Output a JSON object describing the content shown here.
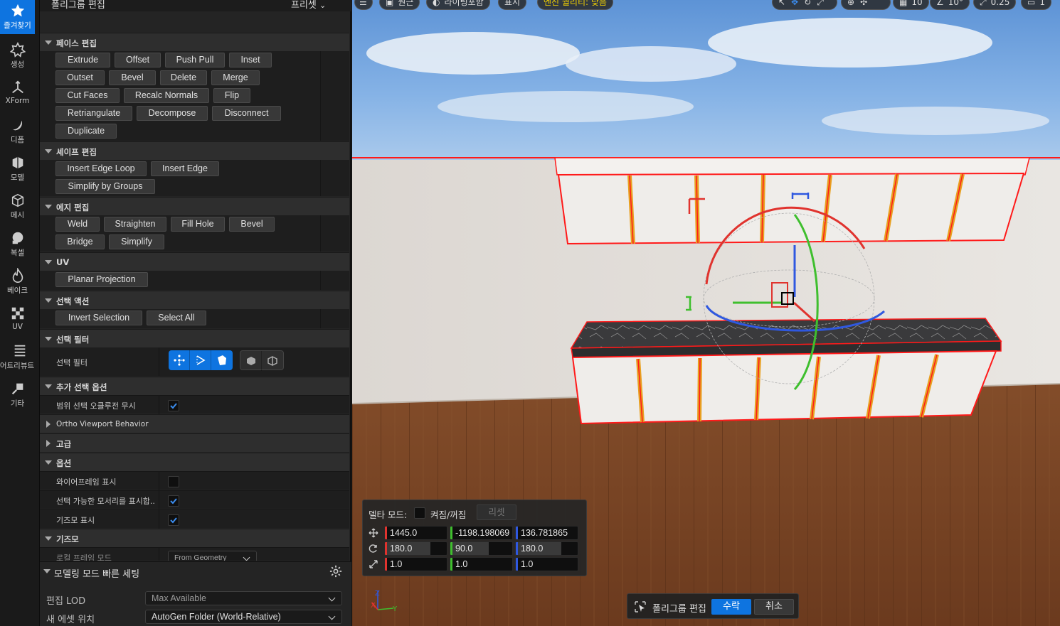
{
  "rail": {
    "items": [
      {
        "label": "즐겨찾기",
        "icon": "star-icon",
        "active": true
      },
      {
        "label": "생성",
        "icon": "create-icon"
      },
      {
        "label": "XForm",
        "icon": "xform-icon"
      },
      {
        "label": "디폼",
        "icon": "deform-icon"
      },
      {
        "label": "모델",
        "icon": "model-icon"
      },
      {
        "label": "메시",
        "icon": "mesh-icon"
      },
      {
        "label": "복셀",
        "icon": "voxel-icon"
      },
      {
        "label": "베이크",
        "icon": "bake-icon"
      },
      {
        "label": "UV",
        "icon": "uv-icon"
      },
      {
        "label": "어트리뷰트",
        "icon": "attributes-icon"
      },
      {
        "label": "기타",
        "icon": "misc-icon"
      }
    ]
  },
  "panel": {
    "title": "폴리그룹 편집",
    "preset_label": "프리셋",
    "sections": {
      "face_edit": "페이스 편집",
      "shape_edit": "셰이프 편집",
      "edge_edit": "에지 편집",
      "uv": "UV",
      "selection_actions": "선택 액션",
      "selection_filter": "선택 필터",
      "extra_selection": "추가 선택 옵션",
      "ortho": "Ortho Viewport Behavior",
      "advanced": "고급",
      "options": "옵션",
      "gizmo": "기즈모"
    },
    "face_buttons": [
      "Extrude",
      "Offset",
      "Push Pull",
      "Inset",
      "Outset",
      "Bevel",
      "Delete",
      "Merge",
      "Cut Faces",
      "Recalc Normals",
      "Flip",
      "Retriangulate",
      "Decompose",
      "Disconnect",
      "Duplicate"
    ],
    "shape_buttons": [
      "Insert Edge Loop",
      "Insert Edge",
      "Simplify by Groups"
    ],
    "edge_buttons": [
      "Weld",
      "Straighten",
      "Fill Hole",
      "Bevel",
      "Bridge",
      "Simplify"
    ],
    "uv_buttons": [
      "Planar Projection"
    ],
    "selection_buttons": [
      "Invert Selection",
      "Select All"
    ],
    "filter_label": "선택 필터",
    "props": {
      "ignore_occlusion": {
        "label": "범위 선택 오클루전 무시",
        "checked": true
      },
      "show_wireframe": {
        "label": "와이어프레임 표시",
        "checked": false
      },
      "show_selectable_edges": {
        "label": "선택 가능한 모서리를 표시합...",
        "checked": true
      },
      "show_gizmo": {
        "label": "기즈모 표시",
        "checked": true
      },
      "local_frame_mode": {
        "label": "로컬 프레임 모드",
        "value": "From Geometry"
      }
    }
  },
  "quick": {
    "title": "모델링 모드 빠른 세팅",
    "edit_lod_label": "편집 LOD",
    "edit_lod_value": "Max Available",
    "asset_location_label": "새 에셋 위치",
    "asset_location_value": "AutoGen Folder (World-Relative)"
  },
  "viewport": {
    "toolbar": {
      "perspective": "원근",
      "lighting": "라이팅포함",
      "show": "표시",
      "scalability": "엔진 퀄리티: 낮음",
      "grid_snap": "10",
      "rot_snap": "10°",
      "scale_snap": "0.25",
      "camera_speed": "1"
    },
    "delta": {
      "mode_label": "델타 모드:",
      "onoff_label": "켜짐/꺼짐",
      "reset_label": "리셋",
      "location": [
        "1445.0",
        "-1198.198069",
        "136.781865"
      ],
      "rotation": [
        "180.0",
        "90.0",
        "180.0"
      ],
      "scale": [
        "1.0",
        "1.0",
        "1.0"
      ]
    },
    "accept_bar": {
      "label": "폴리그룹 편집",
      "accept": "수락",
      "cancel": "취소"
    },
    "colors": {
      "accent": "#0e74e0",
      "x_axis": "#e0332e",
      "y_axis": "#3fbf2e",
      "z_axis": "#2f58e0",
      "selection": "#ff1a1a"
    }
  }
}
